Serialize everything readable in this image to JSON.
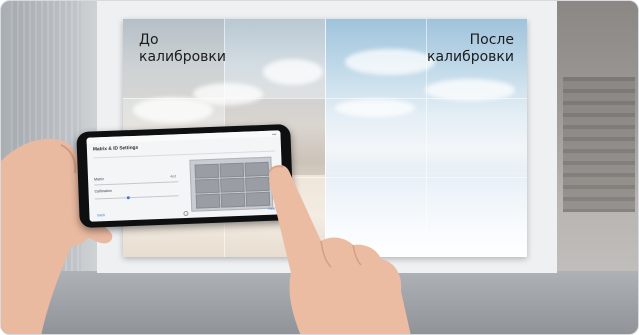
{
  "scene": {
    "before_label": "До\nкалибровки",
    "after_label": "После\nкалибровки"
  },
  "phone_app": {
    "title": "Matrix & ID Settings",
    "fields": [
      {
        "label": "Matrix",
        "value": "4x3"
      },
      {
        "label": "Calibration",
        "value": ""
      }
    ],
    "grid_cells": [
      "",
      "",
      "",
      "",
      "",
      "",
      "",
      "",
      "",
      "",
      "",
      ""
    ],
    "left_button": "Back",
    "right_button": "Next"
  },
  "colors": {
    "before_tint": "#d9d1c6",
    "after_sky": "#9fc3dc",
    "accent": "#3a7bd5"
  }
}
